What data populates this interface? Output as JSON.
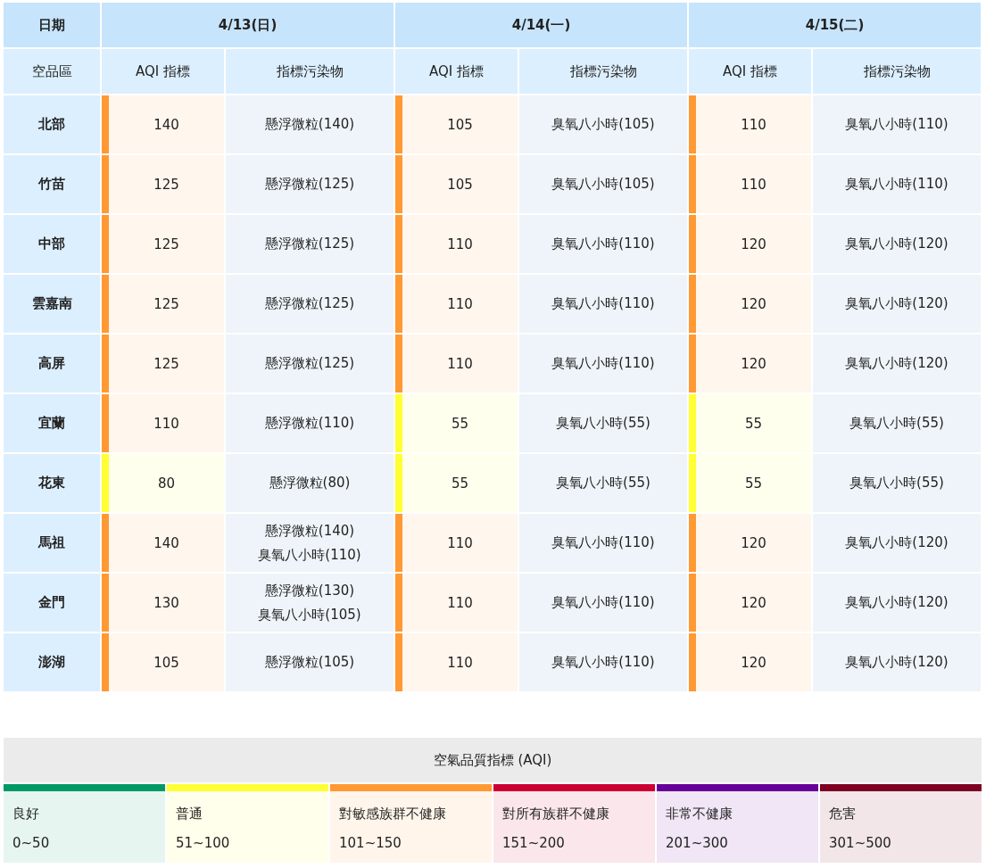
{
  "table": {
    "corner_label": "日期",
    "sub_label": "空品區",
    "dates": [
      {
        "label": "4/13(日)",
        "aqi_heading": "AQI 指標",
        "pollutant_heading": "指標污染物"
      },
      {
        "label": "4/14(一)",
        "aqi_heading": "AQI 指標",
        "pollutant_heading": "指標污染物"
      },
      {
        "label": "4/15(二)",
        "aqi_heading": "AQI 指標",
        "pollutant_heading": "指標污染物"
      }
    ],
    "rows": [
      {
        "region": "北部",
        "days": [
          {
            "aqi": "140",
            "color": "#ff9933",
            "pollutants": [
              "懸浮微粒(140)"
            ]
          },
          {
            "aqi": "105",
            "color": "#ff9933",
            "pollutants": [
              "臭氧八小時(105)"
            ]
          },
          {
            "aqi": "110",
            "color": "#ff9933",
            "pollutants": [
              "臭氧八小時(110)"
            ]
          }
        ]
      },
      {
        "region": "竹苗",
        "days": [
          {
            "aqi": "125",
            "color": "#ff9933",
            "pollutants": [
              "懸浮微粒(125)"
            ]
          },
          {
            "aqi": "105",
            "color": "#ff9933",
            "pollutants": [
              "臭氧八小時(105)"
            ]
          },
          {
            "aqi": "110",
            "color": "#ff9933",
            "pollutants": [
              "臭氧八小時(110)"
            ]
          }
        ]
      },
      {
        "region": "中部",
        "days": [
          {
            "aqi": "125",
            "color": "#ff9933",
            "pollutants": [
              "懸浮微粒(125)"
            ]
          },
          {
            "aqi": "110",
            "color": "#ff9933",
            "pollutants": [
              "臭氧八小時(110)"
            ]
          },
          {
            "aqi": "120",
            "color": "#ff9933",
            "pollutants": [
              "臭氧八小時(120)"
            ]
          }
        ]
      },
      {
        "region": "雲嘉南",
        "days": [
          {
            "aqi": "125",
            "color": "#ff9933",
            "pollutants": [
              "懸浮微粒(125)"
            ]
          },
          {
            "aqi": "110",
            "color": "#ff9933",
            "pollutants": [
              "臭氧八小時(110)"
            ]
          },
          {
            "aqi": "120",
            "color": "#ff9933",
            "pollutants": [
              "臭氧八小時(120)"
            ]
          }
        ]
      },
      {
        "region": "高屏",
        "days": [
          {
            "aqi": "125",
            "color": "#ff9933",
            "pollutants": [
              "懸浮微粒(125)"
            ]
          },
          {
            "aqi": "110",
            "color": "#ff9933",
            "pollutants": [
              "臭氧八小時(110)"
            ]
          },
          {
            "aqi": "120",
            "color": "#ff9933",
            "pollutants": [
              "臭氧八小時(120)"
            ]
          }
        ]
      },
      {
        "region": "宜蘭",
        "days": [
          {
            "aqi": "110",
            "color": "#ff9933",
            "pollutants": [
              "懸浮微粒(110)"
            ]
          },
          {
            "aqi": "55",
            "color": "#ffff33",
            "pollutants": [
              "臭氧八小時(55)"
            ]
          },
          {
            "aqi": "55",
            "color": "#ffff33",
            "pollutants": [
              "臭氧八小時(55)"
            ]
          }
        ]
      },
      {
        "region": "花東",
        "days": [
          {
            "aqi": "80",
            "color": "#ffff33",
            "pollutants": [
              "懸浮微粒(80)"
            ]
          },
          {
            "aqi": "55",
            "color": "#ffff33",
            "pollutants": [
              "臭氧八小時(55)"
            ]
          },
          {
            "aqi": "55",
            "color": "#ffff33",
            "pollutants": [
              "臭氧八小時(55)"
            ]
          }
        ]
      },
      {
        "region": "馬祖",
        "days": [
          {
            "aqi": "140",
            "color": "#ff9933",
            "pollutants": [
              "懸浮微粒(140)",
              "臭氧八小時(110)"
            ]
          },
          {
            "aqi": "110",
            "color": "#ff9933",
            "pollutants": [
              "臭氧八小時(110)"
            ]
          },
          {
            "aqi": "120",
            "color": "#ff9933",
            "pollutants": [
              "臭氧八小時(120)"
            ]
          }
        ]
      },
      {
        "region": "金門",
        "days": [
          {
            "aqi": "130",
            "color": "#ff9933",
            "pollutants": [
              "懸浮微粒(130)",
              "臭氧八小時(105)"
            ]
          },
          {
            "aqi": "110",
            "color": "#ff9933",
            "pollutants": [
              "臭氧八小時(110)"
            ]
          },
          {
            "aqi": "120",
            "color": "#ff9933",
            "pollutants": [
              "臭氧八小時(120)"
            ]
          }
        ]
      },
      {
        "region": "澎湖",
        "days": [
          {
            "aqi": "105",
            "color": "#ff9933",
            "pollutants": [
              "懸浮微粒(105)"
            ]
          },
          {
            "aqi": "110",
            "color": "#ff9933",
            "pollutants": [
              "臭氧八小時(110)"
            ]
          },
          {
            "aqi": "120",
            "color": "#ff9933",
            "pollutants": [
              "臭氧八小時(120)"
            ]
          }
        ]
      }
    ]
  },
  "legend": {
    "title": "空氣品質指標 (AQI)",
    "levels": [
      {
        "label": "良好",
        "range": "0~50",
        "color": "#009966"
      },
      {
        "label": "普通",
        "range": "51~100",
        "color": "#ffff33"
      },
      {
        "label": "對敏感族群不健康",
        "range": "101~150",
        "color": "#ff9933"
      },
      {
        "label": "對所有族群不健康",
        "range": "151~200",
        "color": "#cc0033"
      },
      {
        "label": "非常不健康",
        "range": "201~300",
        "color": "#660099"
      },
      {
        "label": "危害",
        "range": "301~500",
        "color": "#7e0023"
      }
    ]
  }
}
